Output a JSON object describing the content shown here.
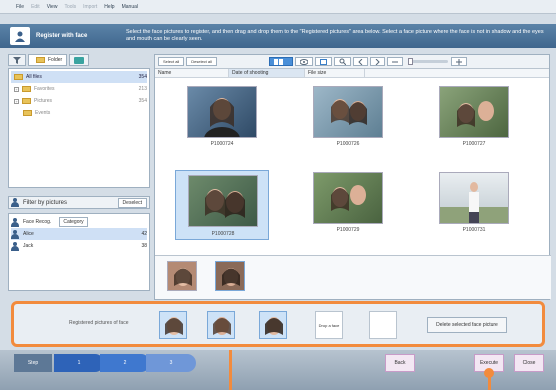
{
  "menu": {
    "items": [
      "File",
      "Edit",
      "View",
      "Tools",
      "Import",
      "Help",
      "Manual"
    ],
    "dim_indices": [
      1,
      3,
      4
    ]
  },
  "header": {
    "title": "Register with face",
    "instruction": "Select the face pictures to register, and then drag and drop them to the \"Registered pictures\" area below. Select a face picture where the face is not in shadow and the eyes and mouth can be clearly seen."
  },
  "left": {
    "tabs": [
      "Folder"
    ],
    "tree": [
      {
        "label": "All files",
        "count": "354",
        "selected": true
      },
      {
        "label": "Favorites",
        "count": "213",
        "selected": false
      },
      {
        "label": "Pictures",
        "count": "354",
        "selected": false
      },
      {
        "label": "Events",
        "count": "",
        "selected": false
      }
    ],
    "faces": {
      "filter_label": "Filter by pictures",
      "filter_button": "Deselect",
      "face_tab": "Face Recog.",
      "category_button": "Category",
      "people": [
        {
          "name": "Alice",
          "count": "42",
          "selected": true
        },
        {
          "name": "Jack",
          "count": "38",
          "selected": false
        }
      ]
    }
  },
  "toolbar": {
    "buttons": [
      "Select all",
      "Deselect all"
    ]
  },
  "columns": [
    "Name",
    "Date of shooting",
    "File size"
  ],
  "photos": [
    {
      "caption": "P1000724",
      "selected": false
    },
    {
      "caption": "P1000726",
      "selected": false
    },
    {
      "caption": "P1000727",
      "selected": false
    },
    {
      "caption": "P1000728",
      "selected": true
    },
    {
      "caption": "P1000729",
      "selected": false
    },
    {
      "caption": "P1000731",
      "selected": false
    }
  ],
  "registration": {
    "label": "Registered pictures of face",
    "drop_label": "Drop a face",
    "delete_button": "Delete selected face picture"
  },
  "footer": {
    "steps": [
      "Step",
      "1",
      "2",
      "3"
    ],
    "back": "Back",
    "execute": "Execute",
    "close": "Close"
  },
  "colors": {
    "accent": "#f28b3d",
    "selection": "#cde2f7",
    "header": "#4a719a"
  }
}
